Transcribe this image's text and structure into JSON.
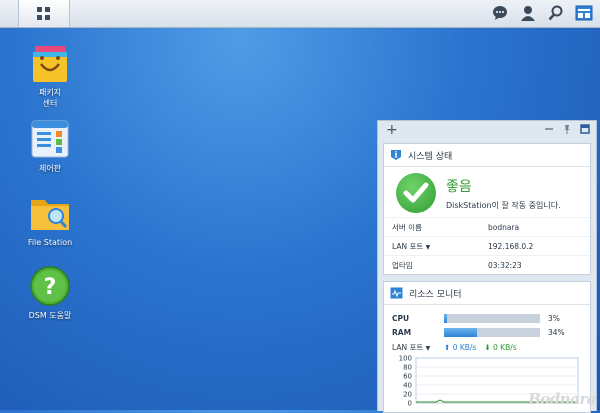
{
  "topbar": {
    "main_menu": "main-menu",
    "icons": [
      "chat-icon",
      "user-icon",
      "search-icon",
      "widgets-icon"
    ]
  },
  "desktop": {
    "items": [
      {
        "label": "패키지\n센터",
        "icon": "package-center-icon"
      },
      {
        "label": "제어판",
        "icon": "control-panel-icon"
      },
      {
        "label": "File Station",
        "icon": "file-station-icon"
      },
      {
        "label": "DSM 도움말",
        "icon": "help-icon"
      }
    ]
  },
  "system_health": {
    "title": "시스템 상태",
    "status": "좋음",
    "message": "DiskStation이 잘 작동 중입니다.",
    "rows": [
      {
        "key": "서버 이름",
        "value": "bodnara"
      },
      {
        "key": "LAN 포트",
        "value": "192.168.0.2"
      },
      {
        "key": "업타임",
        "value": "03:32:23"
      }
    ]
  },
  "resource_monitor": {
    "title": "리소스 모니터",
    "cpu": {
      "label": "CPU",
      "percent": 3,
      "display": "3%"
    },
    "ram": {
      "label": "RAM",
      "percent": 34,
      "display": "34%"
    },
    "net": {
      "label": "LAN 포트",
      "up": "0 KB/s",
      "down": "0 KB/s"
    },
    "chart": {
      "y_ticks": [
        "100",
        "80",
        "60",
        "40",
        "20",
        "0"
      ]
    }
  },
  "watermark": "Bodnara",
  "colors": {
    "accent": "#2e83d6",
    "good": "#2f9b33"
  }
}
